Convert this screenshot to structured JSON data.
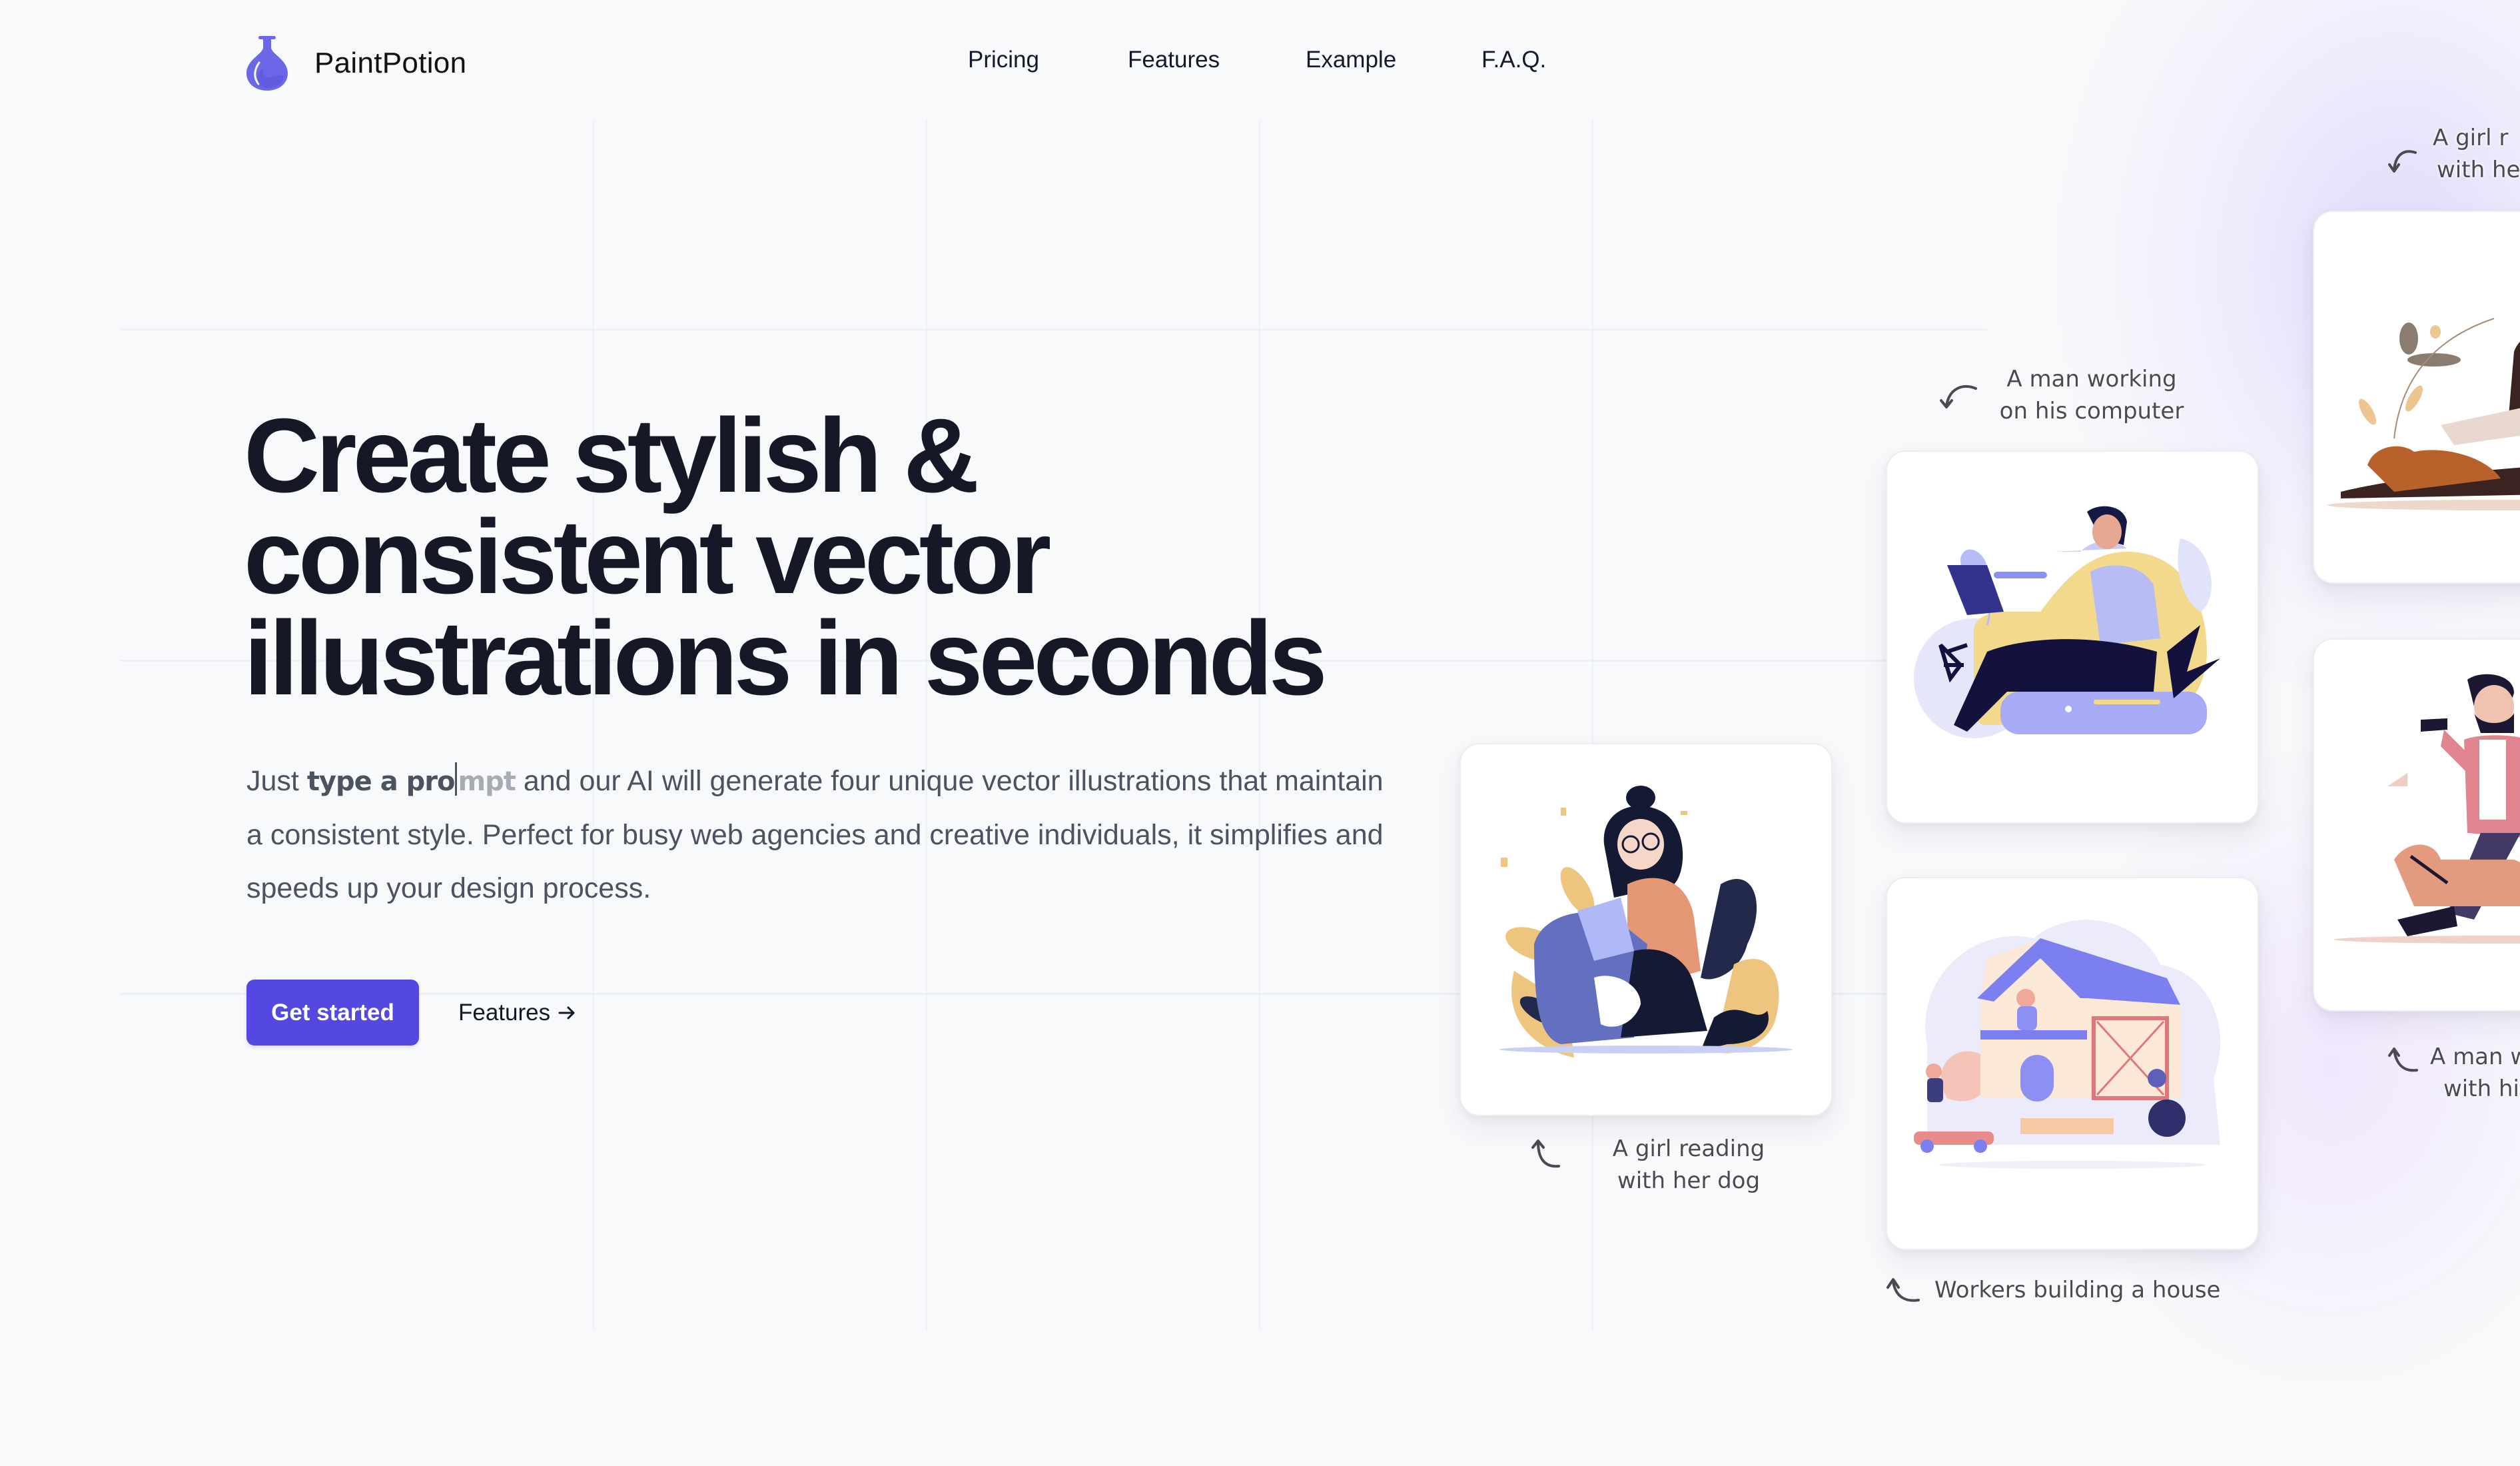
{
  "brand": {
    "name": "PaintPotion",
    "logo_icon": "flask-icon",
    "accent_color": "#5448e0",
    "logo_color": "#6b67e8"
  },
  "nav": {
    "items": [
      {
        "label": "Pricing"
      },
      {
        "label": "Features"
      },
      {
        "label": "Example"
      },
      {
        "label": "F.A.Q."
      }
    ]
  },
  "hero": {
    "headline_lines": [
      "Create stylish &",
      "consistent vector",
      "illustrations in seconds"
    ],
    "lead_prefix": "Just ",
    "typed_text": "type a pro",
    "typed_ghost": "mpt",
    "lead_suffix": " and our AI will generate four unique vector illustrations that maintain a consistent style. Perfect for busy web agencies and creative individuals, it simplifies and speeds up your design process.",
    "primary_cta": "Get started",
    "secondary_cta": "Features",
    "secondary_cta_icon": "arrow-right-icon"
  },
  "examples": [
    {
      "caption_line1": "A girl reading",
      "caption_line2": "with her dog",
      "illustration": "girl-reading-with-dog"
    },
    {
      "caption_line1": "A man working",
      "caption_line2": "on his computer",
      "illustration": "man-working-on-laptop"
    },
    {
      "caption_line1": "Workers building a house",
      "caption_line2": "",
      "illustration": "workers-building-house"
    },
    {
      "caption_line1": "A girl r",
      "caption_line2": "with he",
      "illustration": "girl-reading-with-dog-2"
    },
    {
      "caption_line1": "A man w",
      "caption_line2": "with hi",
      "illustration": "man-walking-dog"
    }
  ]
}
